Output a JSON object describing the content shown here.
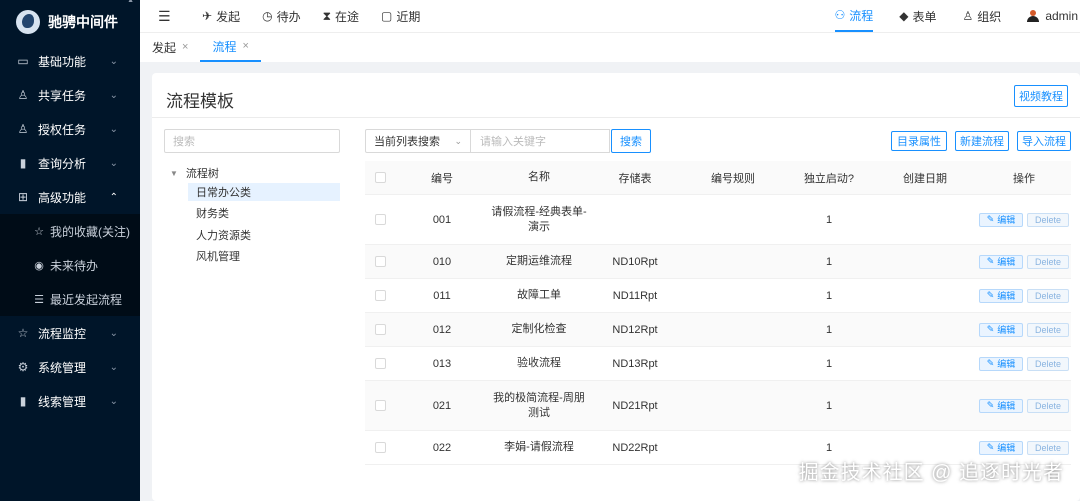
{
  "app": {
    "logo_text": "驰骋中间件"
  },
  "sidebar": {
    "items": [
      {
        "label": "基础功能",
        "icon": "folder-icon"
      },
      {
        "label": "共享任务",
        "icon": "users-icon"
      },
      {
        "label": "授权任务",
        "icon": "user-group-icon"
      },
      {
        "label": "查询分析",
        "icon": "bar-chart-icon"
      },
      {
        "label": "高级功能",
        "icon": "grid-icon"
      },
      {
        "label": "流程监控",
        "icon": "star-icon"
      },
      {
        "label": "系统管理",
        "icon": "gear-icon"
      },
      {
        "label": "线索管理",
        "icon": "bar-chart-icon"
      }
    ],
    "submenu": [
      {
        "label": "我的收藏(关注)",
        "icon": "star-icon"
      },
      {
        "label": "未来待办",
        "icon": "eye-icon"
      },
      {
        "label": "最近发起流程",
        "icon": "list-icon"
      }
    ]
  },
  "header": {
    "left": [
      "发起",
      "待办",
      "在途",
      "近期"
    ],
    "right": [
      "流程",
      "表单",
      "组织"
    ],
    "user": "admin"
  },
  "tabs": [
    "发起",
    "流程"
  ],
  "page": {
    "title": "流程模板",
    "video_btn": "视频教程",
    "tree_search_placeholder": "搜索",
    "tree_root": "流程树",
    "tree_nodes": [
      "日常办公类",
      "财务类",
      "人力资源类",
      "风机管理"
    ],
    "search_scope": "当前列表搜索",
    "keyword_placeholder": "请输入关键字",
    "search_btn": "搜索",
    "dir_btn": "目录属性",
    "new_btn": "新建流程",
    "import_btn": "导入流程"
  },
  "table": {
    "headers": [
      "编号",
      "名称",
      "存储表",
      "编号规则",
      "独立启动?",
      "创建日期",
      "操作"
    ],
    "edit_label": "编辑",
    "delete_label": "Delete",
    "rows": [
      {
        "no": "001",
        "name": "请假流程-经典表单-演示",
        "store": "",
        "rule": "",
        "independent": "1",
        "date": ""
      },
      {
        "no": "010",
        "name": "定期运维流程",
        "store": "ND10Rpt",
        "rule": "",
        "independent": "1",
        "date": ""
      },
      {
        "no": "011",
        "name": "故障工单",
        "store": "ND11Rpt",
        "rule": "",
        "independent": "1",
        "date": ""
      },
      {
        "no": "012",
        "name": "定制化检查",
        "store": "ND12Rpt",
        "rule": "",
        "independent": "1",
        "date": ""
      },
      {
        "no": "013",
        "name": "验收流程",
        "store": "ND13Rpt",
        "rule": "",
        "independent": "1",
        "date": ""
      },
      {
        "no": "021",
        "name": "我的极简流程-周朋测试",
        "store": "ND21Rpt",
        "rule": "",
        "independent": "1",
        "date": ""
      },
      {
        "no": "022",
        "name": "李娟-请假流程",
        "store": "ND22Rpt",
        "rule": "",
        "independent": "1",
        "date": ""
      }
    ]
  },
  "watermark": "掘金技术社区 @ 追逐时光者"
}
